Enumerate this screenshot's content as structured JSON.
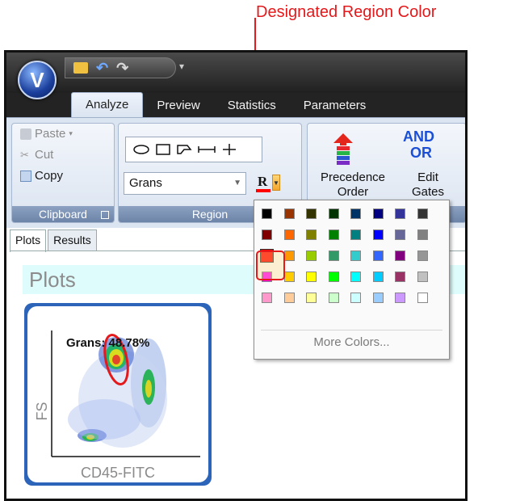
{
  "annotation": {
    "text": "Designated Region Color",
    "color": "#e3191b"
  },
  "app": {
    "orb_letter": "V"
  },
  "quick_access": {
    "items": [
      "open-icon",
      "undo-icon",
      "redo-icon"
    ]
  },
  "tabs": [
    {
      "label": "Analyze",
      "active": true
    },
    {
      "label": "Preview",
      "active": false
    },
    {
      "label": "Statistics",
      "active": false
    },
    {
      "label": "Parameters",
      "active": false
    }
  ],
  "ribbon": {
    "clipboard": {
      "label": "Clipboard",
      "paste": "Paste",
      "cut": "Cut",
      "copy": "Copy"
    },
    "region": {
      "label": "Region",
      "selected_region": "Grans",
      "color_button_letter": "R",
      "current_color": "#ff0000",
      "shapes": [
        "ellipse-icon",
        "rectangle-icon",
        "polygon-icon",
        "linear-icon",
        "quadrant-icon"
      ]
    },
    "gates": {
      "precedence_label_1": "Precedence",
      "precedence_label_2": "Order",
      "and_label": "AND",
      "or_label": "OR",
      "edit_label_1": "Edit",
      "edit_label_2": "Gates"
    }
  },
  "doc_tabs": [
    {
      "label": "Plots",
      "active": true
    },
    {
      "label": "Results",
      "active": false
    }
  ],
  "plots": {
    "header": "Plots",
    "plot_title": "Grans: 48.78%",
    "y_label": "FS",
    "x_label": "CD45-FITC"
  },
  "color_palette": {
    "rows": [
      [
        "#000000",
        "#993300",
        "#333300",
        "#003300",
        "#003366",
        "#000080",
        "#333399",
        "#333333"
      ],
      [
        "#800000",
        "#ff6600",
        "#808000",
        "#008000",
        "#008080",
        "#0000ff",
        "#666699",
        "#808080"
      ],
      [
        "#ff0000",
        "#ff9900",
        "#99cc00",
        "#339966",
        "#33cccc",
        "#3366ff",
        "#800080",
        "#969696"
      ],
      [
        "#ff00ff",
        "#ffcc00",
        "#ffff00",
        "#00ff00",
        "#00ffff",
        "#00ccff",
        "#993366",
        "#c0c0c0"
      ],
      [
        "#ff99cc",
        "#ffcc99",
        "#ffff99",
        "#ccffcc",
        "#ccffff",
        "#99ccff",
        "#cc99ff",
        "#ffffff"
      ]
    ],
    "selected": "#ff0000",
    "more_colors": "More Colors..."
  }
}
